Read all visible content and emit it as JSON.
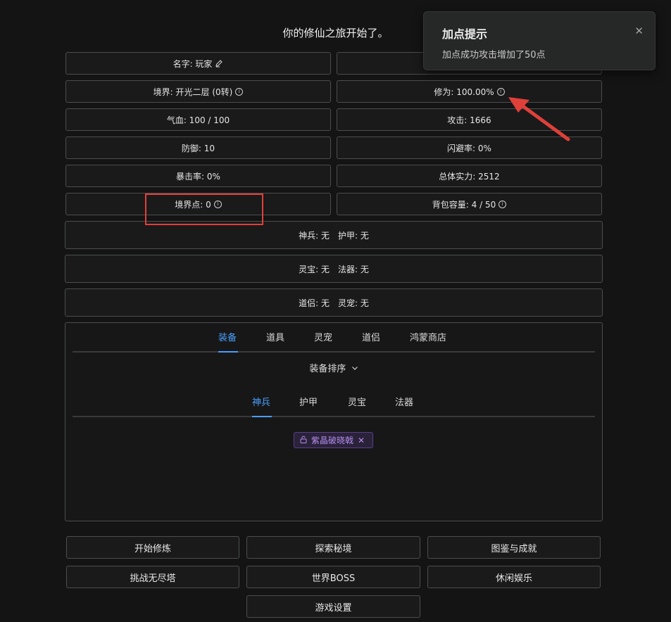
{
  "message": "你的修仙之旅开始了。",
  "stats": {
    "name_label": "名字: 玩家",
    "realm_label": "境界: 开光二层 (0转)",
    "cultivation_label": "修为: 100.00%",
    "hp_label": "气血: 100 / 100",
    "attack_label": "攻击: 1666",
    "defense_label": "防御: 10",
    "dodge_label": "闪避率: 0%",
    "crit_label": "暴击率: 0%",
    "power_label": "总体实力: 2512",
    "realm_points_label": "境界点: 0",
    "bag_label": "背包容量: 4 / 50"
  },
  "equipment_slots": {
    "weapon": "神兵: 无",
    "armor": "护甲: 无",
    "treasure": "灵宝: 无",
    "artifact": "法器: 无",
    "companion": "道侣: 无",
    "pet": "灵宠: 无"
  },
  "main_tabs": [
    "装备",
    "道具",
    "灵宠",
    "道侣",
    "鸿蒙商店"
  ],
  "sort_label": "装备排序",
  "sub_tabs": [
    "神兵",
    "护甲",
    "灵宝",
    "法器"
  ],
  "item_chip": "紫晶破晓戟",
  "actions": [
    "开始修炼",
    "探索秘境",
    "图鉴与成就",
    "挑战无尽塔",
    "世界BOSS",
    "休闲娱乐",
    "游戏设置"
  ],
  "toast": {
    "title": "加点提示",
    "message": "加点成功攻击增加了50点"
  },
  "colors": {
    "accent": "#4a9eff",
    "item_purple": "#b48cf0",
    "annotation_red": "#e0403a"
  }
}
